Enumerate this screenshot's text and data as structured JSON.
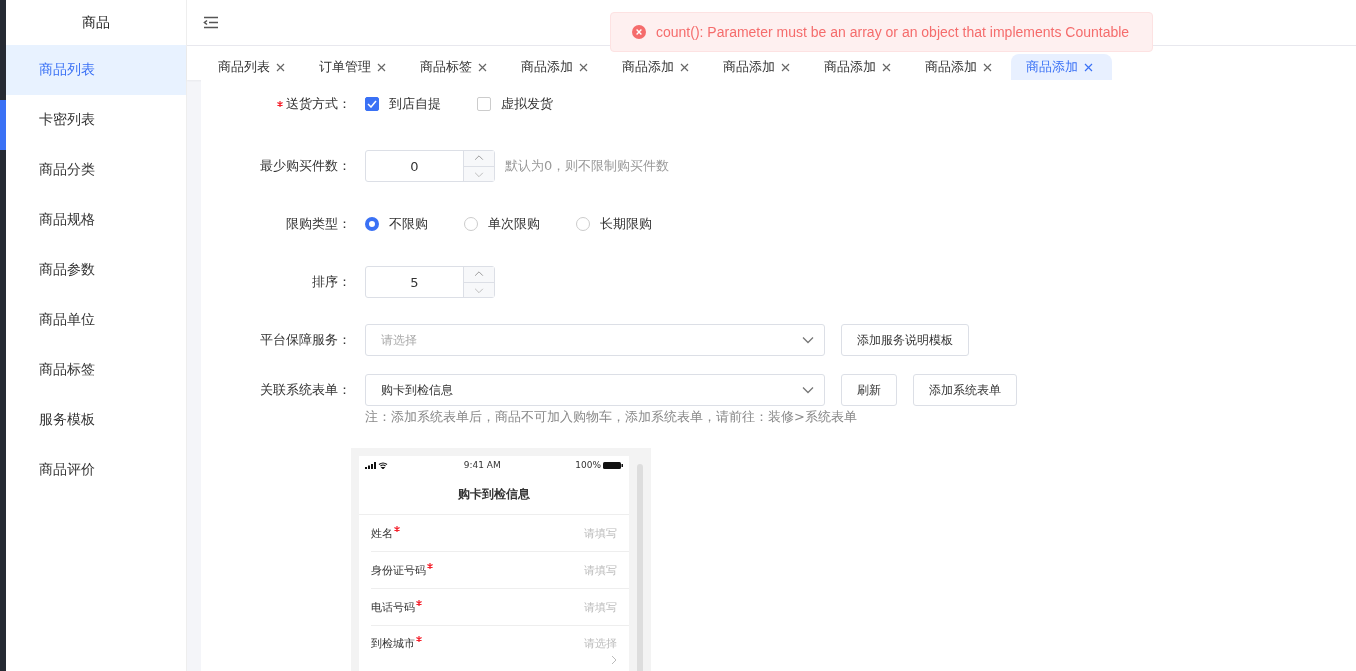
{
  "sidebar": {
    "title": "商品",
    "items": [
      {
        "label": "商品列表",
        "selected": true
      },
      {
        "label": "卡密列表",
        "selected": false
      },
      {
        "label": "商品分类",
        "selected": false
      },
      {
        "label": "商品规格",
        "selected": false
      },
      {
        "label": "商品参数",
        "selected": false
      },
      {
        "label": "商品单位",
        "selected": false
      },
      {
        "label": "商品标签",
        "selected": false
      },
      {
        "label": "服务模板",
        "selected": false
      },
      {
        "label": "商品评价",
        "selected": false
      }
    ]
  },
  "tabs": [
    {
      "label": "商品列表",
      "selected": false
    },
    {
      "label": "订单管理",
      "selected": false
    },
    {
      "label": "商品标签",
      "selected": false
    },
    {
      "label": "商品添加",
      "selected": false
    },
    {
      "label": "商品添加",
      "selected": false
    },
    {
      "label": "商品添加",
      "selected": false
    },
    {
      "label": "商品添加",
      "selected": false
    },
    {
      "label": "商品添加",
      "selected": false
    },
    {
      "label": "商品添加",
      "selected": true
    }
  ],
  "toast": {
    "message": "count(): Parameter must be an array or an object that implements Countable"
  },
  "form": [
    {
      "kind": "checks",
      "label": "送货方式：",
      "required": true,
      "options": [
        {
          "label": "到店自提",
          "checked": true
        },
        {
          "label": "虚拟发货",
          "checked": false
        }
      ]
    },
    {
      "kind": "number",
      "label": "最少购买件数：",
      "required": false,
      "value": "0",
      "hint": "默认为0，则不限制购买件数"
    },
    {
      "kind": "radios",
      "label": "限购类型：",
      "required": false,
      "options": [
        {
          "label": "不限购",
          "selected": true
        },
        {
          "label": "单次限购",
          "selected": false
        },
        {
          "label": "长期限购",
          "selected": false
        }
      ]
    },
    {
      "kind": "number",
      "label": "排序：",
      "required": false,
      "value": "5"
    },
    {
      "kind": "select",
      "label": "平台保障服务：",
      "required": false,
      "placeholder": "请选择",
      "buttons": [
        "添加服务说明模板"
      ]
    },
    {
      "kind": "select",
      "label": "关联系统表单：",
      "required": false,
      "value": "购卡到检信息",
      "buttons": [
        "刷新",
        "添加系统表单"
      ],
      "note": "注：添加系统表单后，商品不可加入购物车，添加系统表单，请前往：装修>系统表单"
    }
  ],
  "preview": {
    "time": "9:41 AM",
    "battery": "100%",
    "title": "购卡到检信息",
    "fields": [
      {
        "label": "姓名",
        "required": true,
        "placeholder": "请填写",
        "kind": "input"
      },
      {
        "label": "身份证号码",
        "required": true,
        "placeholder": "请填写",
        "kind": "input"
      },
      {
        "label": "电话号码",
        "required": true,
        "placeholder": "请填写",
        "kind": "input"
      },
      {
        "label": "到检城市",
        "required": true,
        "placeholder": "请选择",
        "kind": "picker"
      }
    ]
  }
}
